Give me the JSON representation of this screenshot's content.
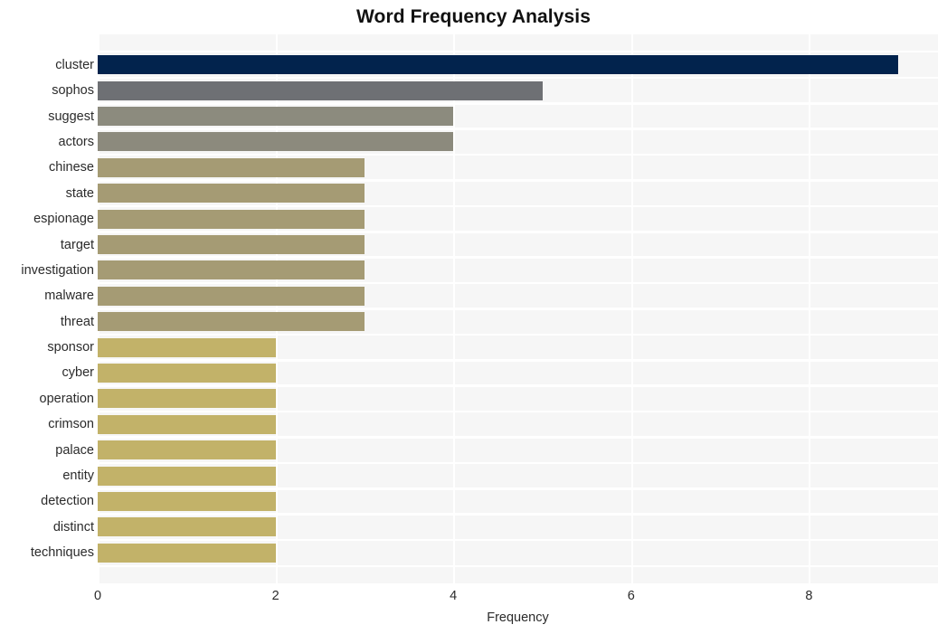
{
  "chart_data": {
    "type": "bar",
    "orientation": "horizontal",
    "title": "Word Frequency Analysis",
    "xlabel": "Frequency",
    "ylabel": "",
    "categories": [
      "cluster",
      "sophos",
      "suggest",
      "actors",
      "chinese",
      "state",
      "espionage",
      "target",
      "investigation",
      "malware",
      "threat",
      "sponsor",
      "cyber",
      "operation",
      "crimson",
      "palace",
      "entity",
      "detection",
      "distinct",
      "techniques"
    ],
    "values": [
      9,
      5,
      4,
      4,
      3,
      3,
      3,
      3,
      3,
      3,
      3,
      2,
      2,
      2,
      2,
      2,
      2,
      2,
      2,
      2
    ],
    "bar_colors": [
      "#02234d",
      "#6e7074",
      "#8c8b7e",
      "#8c8a7d",
      "#a59b74",
      "#a59b74",
      "#a59b74",
      "#a59b74",
      "#a59b74",
      "#a59b74",
      "#a59b74",
      "#c2b269",
      "#c2b269",
      "#c2b269",
      "#c2b269",
      "#c2b269",
      "#c2b269",
      "#c2b269",
      "#c2b269",
      "#c2b269"
    ],
    "xlim": [
      0,
      9.45
    ],
    "xticks": [
      0,
      2,
      4,
      6,
      8
    ],
    "xtick_labels": [
      "0",
      "2",
      "4",
      "6",
      "8"
    ],
    "grid": true,
    "grid_color": "#ffffff",
    "plot_background": "#f6f6f6",
    "figure_background": "#ffffff",
    "legend": null
  }
}
